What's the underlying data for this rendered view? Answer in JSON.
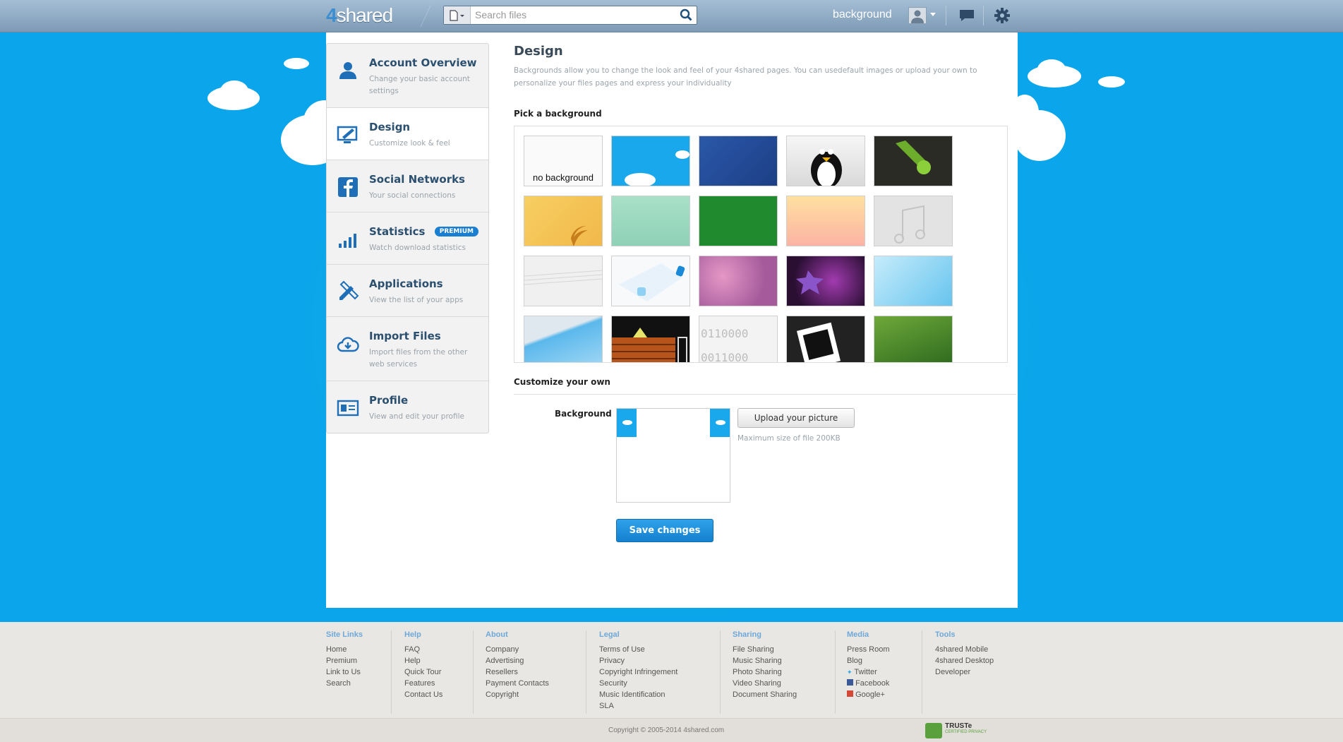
{
  "header": {
    "logo_four": "4",
    "logo_rest": "shared",
    "search_placeholder": "Search files",
    "username": "background"
  },
  "sidebar": {
    "items": [
      {
        "title": "Account Overview",
        "subtitle": "Change your basic account settings",
        "icon": "user-icon"
      },
      {
        "title": "Design",
        "subtitle": "Customize look & feel",
        "icon": "monitor-brush-icon"
      },
      {
        "title": "Social Networks",
        "subtitle": "Your social connections",
        "icon": "facebook-icon"
      },
      {
        "title": "Statistics",
        "subtitle": "Watch download statistics",
        "icon": "bar-chart-icon",
        "badge": "PREMIUM"
      },
      {
        "title": "Applications",
        "subtitle": "View the list of your apps",
        "icon": "pencil-ruler-icon"
      },
      {
        "title": "Import Files",
        "subtitle": "Import files from the other web services",
        "icon": "cloud-import-icon"
      },
      {
        "title": "Profile",
        "subtitle": "View and edit your profile",
        "icon": "id-card-icon"
      }
    ],
    "active_index": 1
  },
  "main": {
    "title": "Design",
    "description": "Backgrounds allow you to change the look and feel of your 4shared pages. You can usedefault images or upload your own to personalize your files pages and express your individuality",
    "pick_title": "Pick a background",
    "no_background_label": "no background",
    "customize_title": "Customize your own",
    "background_label": "Background",
    "upload_button": "Upload your picture",
    "max_size": "Maximum size of file 200KB",
    "save_button": "Save changes"
  },
  "footer": {
    "columns": [
      {
        "heading": "Site Links",
        "links": [
          "Home",
          "Premium",
          "Link to Us",
          "Search"
        ]
      },
      {
        "heading": "Help",
        "links": [
          "FAQ",
          "Help",
          "Quick Tour",
          "Features",
          "Contact Us"
        ]
      },
      {
        "heading": "About",
        "links": [
          "Company",
          "Advertising",
          "Resellers",
          "Payment Contacts",
          "Copyright"
        ]
      },
      {
        "heading": "Legal",
        "links": [
          "Terms of Use",
          "Privacy",
          "Copyright Infringement",
          "Security",
          "Music Identification",
          "SLA"
        ]
      },
      {
        "heading": "Sharing",
        "links": [
          "File Sharing",
          "Music Sharing",
          "Photo Sharing",
          "Video Sharing",
          "Document Sharing"
        ]
      },
      {
        "heading": "Media",
        "links": [
          "Press Room",
          "Blog",
          "Twitter",
          "Facebook",
          "Google+"
        ]
      },
      {
        "heading": "Tools",
        "links": [
          "4shared Mobile",
          "4shared Desktop",
          "Developer"
        ]
      }
    ],
    "copyright": "Copyright © 2005-2014 4shared.com",
    "truste": "TRUSTe",
    "truste_sub": "CERTIFIED PRIVACY"
  },
  "colors": {
    "sky": "#0aa5ea",
    "accent": "#1a7fd0",
    "heading": "#2b4f6e"
  }
}
